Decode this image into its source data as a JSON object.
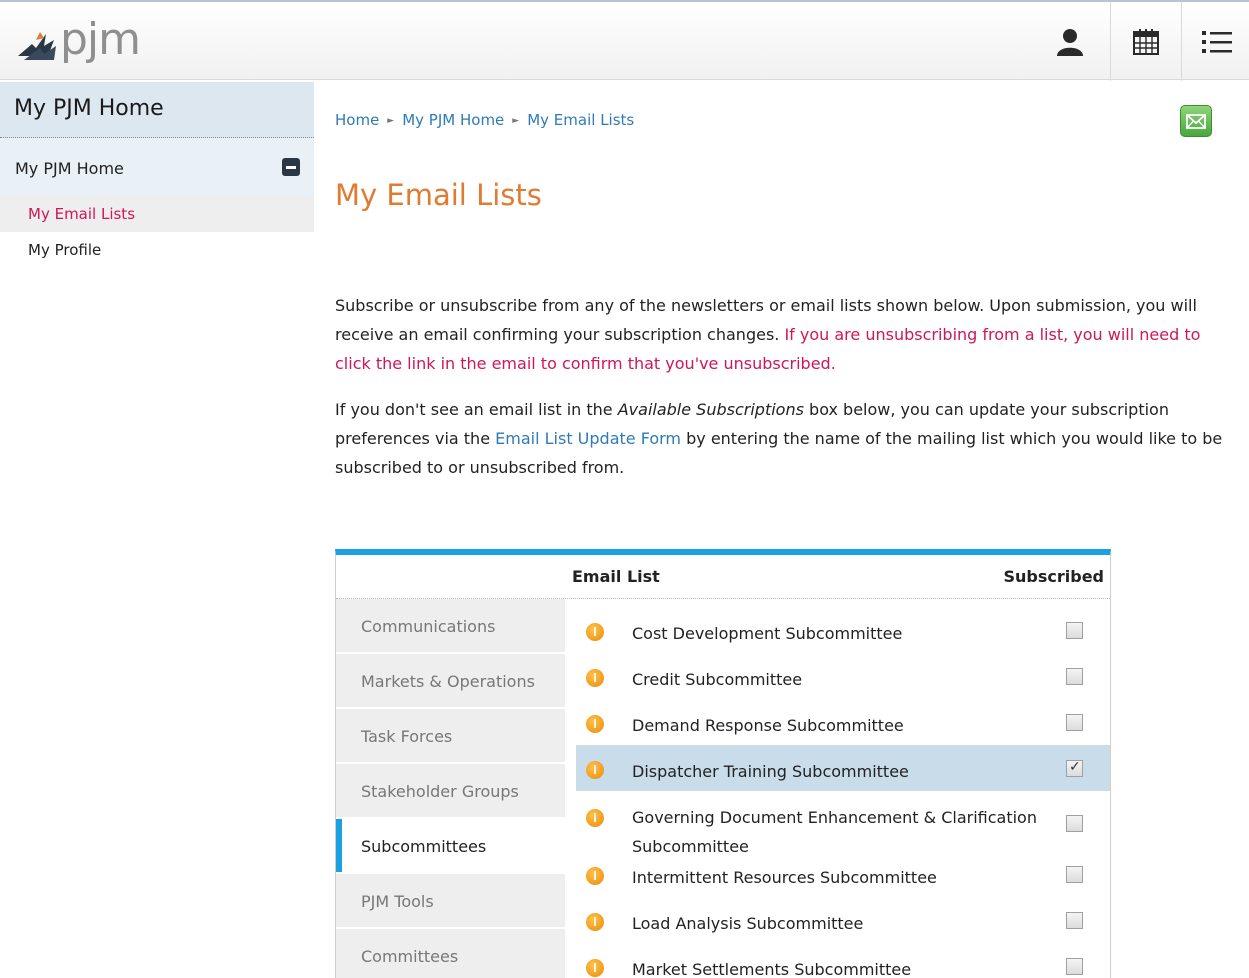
{
  "header": {
    "logo_text": "pjm",
    "icons": [
      "user-icon",
      "calendar-icon",
      "menu-list-icon"
    ]
  },
  "sidebar": {
    "title": "My PJM Home",
    "section": "My PJM Home",
    "items": [
      {
        "label": "My Email Lists",
        "active": true
      },
      {
        "label": "My Profile",
        "active": false
      }
    ]
  },
  "breadcrumb": [
    "Home",
    "My PJM Home",
    "My Email Lists"
  ],
  "page": {
    "title": "My Email Lists",
    "para1_a": "Subscribe or unsubscribe from any of the newsletters or email lists shown below. Upon submission, you will receive an email confirming your subscription changes.",
    "para1_b": "If you are unsubscribing from a list, you will need to click the link in the email to confirm that you've unsubscribed.",
    "para2_a": "If you don't see an email list in the",
    "para2_em": "Available Subscriptions",
    "para2_b": "box below, you can update your subscription preferences via the",
    "para2_link": "Email List Update Form",
    "para2_c": "by entering the name of the mailing list which you would like to be subscribed to or unsubscribed from."
  },
  "table": {
    "col_list": "Email List",
    "col_subscribed": "Subscribed",
    "tabs": [
      {
        "label": "Communications",
        "active": false
      },
      {
        "label": "Markets & Operations",
        "active": false
      },
      {
        "label": "Task Forces",
        "active": false
      },
      {
        "label": "Stakeholder Groups",
        "active": false
      },
      {
        "label": "Subcommittees",
        "active": true
      },
      {
        "label": "PJM Tools",
        "active": false
      },
      {
        "label": "Committees",
        "active": false
      }
    ],
    "rows": [
      {
        "label": "Cost Development Subcommittee",
        "checked": false
      },
      {
        "label": "Credit Subcommittee",
        "checked": false
      },
      {
        "label": "Demand Response Subcommittee",
        "checked": false
      },
      {
        "label": "Dispatcher Training Subcommittee",
        "checked": true
      },
      {
        "label": "Governing Document Enhancement & Clarification Subcommittee",
        "checked": false
      },
      {
        "label": "Intermittent Resources Subcommittee",
        "checked": false
      },
      {
        "label": "Load Analysis Subcommittee",
        "checked": false
      },
      {
        "label": "Market Settlements Subcommittee",
        "checked": false
      }
    ]
  },
  "colors": {
    "accent": "#1ba0e2",
    "title": "#e07b31",
    "pink": "#d0155a",
    "link": "#2f7ab9"
  }
}
